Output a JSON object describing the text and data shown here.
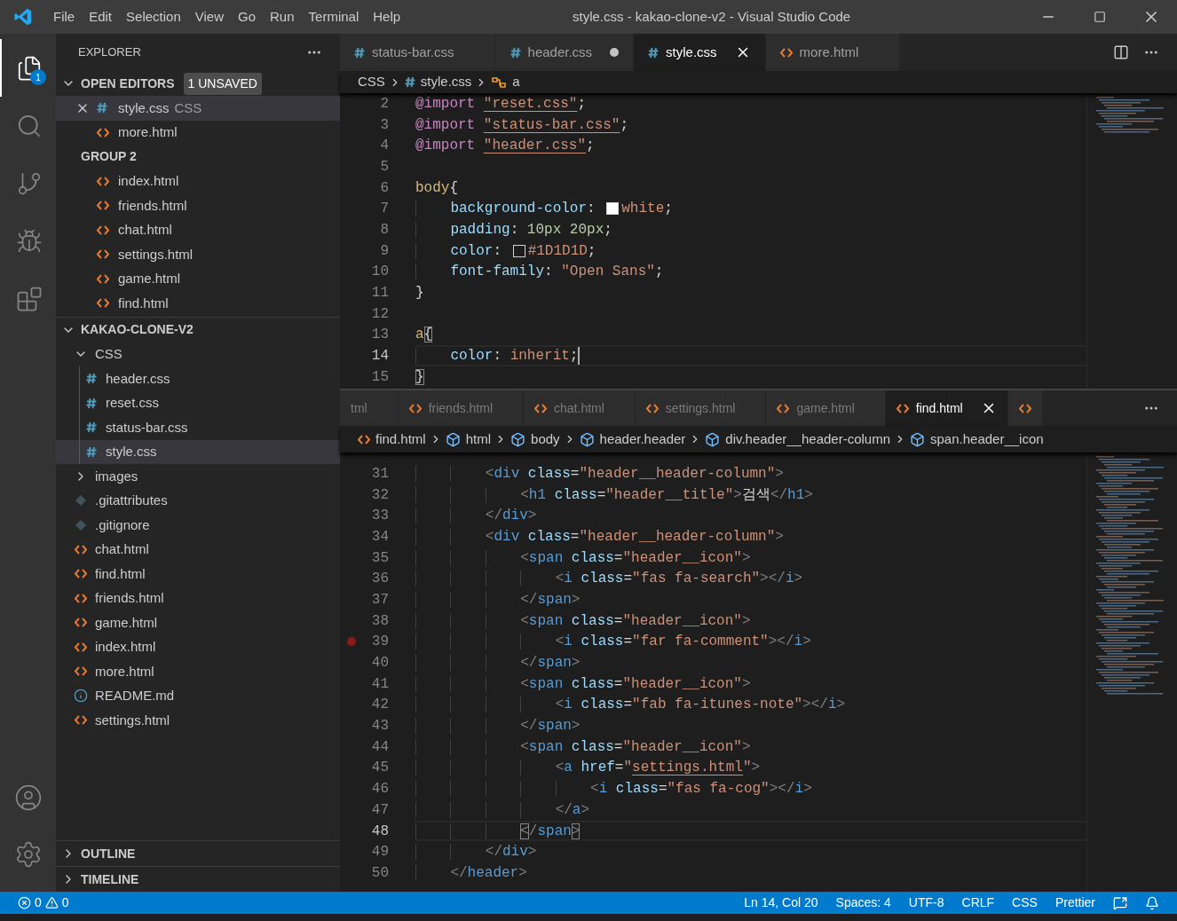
{
  "title_bar": {
    "menu": [
      "File",
      "Edit",
      "Selection",
      "View",
      "Go",
      "Run",
      "Terminal",
      "Help"
    ],
    "title": "style.css - kakao-clone-v2 - Visual Studio Code"
  },
  "activity_bar": {
    "items": [
      {
        "kind": "files",
        "selected": true,
        "badge": "1"
      },
      {
        "kind": "search",
        "selected": false
      },
      {
        "kind": "source-control",
        "selected": false
      },
      {
        "kind": "run",
        "selected": false
      },
      {
        "kind": "extensions",
        "selected": false
      }
    ],
    "bottom": [
      {
        "kind": "account"
      },
      {
        "kind": "settings"
      }
    ]
  },
  "sidebar": {
    "title": "EXPLORER",
    "open_editors": {
      "label": "OPEN EDITORS",
      "expanded": true,
      "badge": "1 UNSAVED",
      "groups": [
        {
          "items": [
            {
              "name": "style.css",
              "kind": "css",
              "selected": true,
              "close": true,
              "suffix": "CSS"
            },
            {
              "name": "more.html",
              "kind": "html",
              "selected": false,
              "close": false
            }
          ]
        },
        {
          "title": "GROUP 2",
          "items": [
            {
              "name": "index.html",
              "kind": "html",
              "selected": false,
              "close": false
            },
            {
              "name": "friends.html",
              "kind": "html",
              "selected": false,
              "close": false
            },
            {
              "name": "chat.html",
              "kind": "html",
              "selected": false,
              "close": false
            },
            {
              "name": "settings.html",
              "kind": "html",
              "selected": false,
              "close": false
            },
            {
              "name": "game.html",
              "kind": "html",
              "selected": false,
              "close": false
            },
            {
              "name": "find.html",
              "kind": "html",
              "selected": false,
              "close": false
            }
          ]
        }
      ]
    },
    "folder": {
      "label": "KAKAO-CLONE-V2",
      "expanded": true,
      "children": [
        {
          "name": "CSS",
          "kind": "folder",
          "expanded": true,
          "selected": false,
          "children": [
            {
              "name": "header.css",
              "kind": "css",
              "selected": false
            },
            {
              "name": "reset.css",
              "kind": "css",
              "selected": false
            },
            {
              "name": "status-bar.css",
              "kind": "css",
              "selected": false
            },
            {
              "name": "style.css",
              "kind": "css",
              "selected": true
            }
          ]
        },
        {
          "name": "images",
          "kind": "folder",
          "expanded": false,
          "selected": false
        },
        {
          "name": ".gitattributes",
          "kind": "git",
          "selected": false
        },
        {
          "name": ".gitignore",
          "kind": "git",
          "selected": false
        },
        {
          "name": "chat.html",
          "kind": "html",
          "selected": false
        },
        {
          "name": "find.html",
          "kind": "html",
          "selected": false
        },
        {
          "name": "friends.html",
          "kind": "html",
          "selected": false
        },
        {
          "name": "game.html",
          "kind": "html",
          "selected": false
        },
        {
          "name": "index.html",
          "kind": "html",
          "selected": false
        },
        {
          "name": "more.html",
          "kind": "html",
          "selected": false
        },
        {
          "name": "README.md",
          "kind": "info",
          "selected": false
        },
        {
          "name": "settings.html",
          "kind": "html",
          "selected": false
        }
      ]
    },
    "panels": [
      {
        "label": "OUTLINE",
        "expanded": false
      },
      {
        "label": "TIMELINE",
        "expanded": false
      }
    ]
  },
  "editor_1": {
    "tabs": [
      {
        "label": "status-bar.css",
        "kind": "css",
        "selected": false,
        "dirty": false,
        "close": false
      },
      {
        "label": "header.css",
        "kind": "css",
        "selected": false,
        "dirty": true,
        "close": false
      },
      {
        "label": "style.css",
        "kind": "css",
        "selected": true,
        "dirty": false,
        "close": true
      },
      {
        "label": "more.html",
        "kind": "html",
        "selected": false,
        "dirty": false,
        "close": false
      }
    ],
    "breadcrumbs": [
      {
        "label": "CSS",
        "kind": "none"
      },
      {
        "label": "style.css",
        "kind": "css"
      },
      {
        "label": "a",
        "kind": "symbol"
      }
    ],
    "lines": [
      {
        "n": "2",
        "text": "@import \"reset.css\";"
      },
      {
        "n": "3",
        "text": "@import \"status-bar.css\";"
      },
      {
        "n": "4",
        "text": "@import \"header.css\";"
      },
      {
        "n": "5"
      },
      {
        "n": "6",
        "text": "body{"
      },
      {
        "n": "7",
        "segments": [
          {
            "kind": "code",
            "text": "    background-color: "
          },
          {
            "kind": "swatch",
            "color": "#ffffff"
          },
          {
            "kind": "code",
            "text": "white;"
          }
        ]
      },
      {
        "n": "8",
        "text": "    padding: 10px 20px;"
      },
      {
        "n": "9",
        "segments": [
          {
            "kind": "code",
            "text": "    color: "
          },
          {
            "kind": "swatch",
            "color": "#1d1d1d"
          },
          {
            "kind": "code",
            "text": "#1D1D1D;"
          }
        ]
      },
      {
        "n": "10",
        "text": "    font-family: \"Open Sans\";"
      },
      {
        "n": "11",
        "text": "}"
      },
      {
        "n": "12"
      },
      {
        "n": "13",
        "text": "a{",
        "bracket_match": true
      },
      {
        "n": "14",
        "text": "    color: inherit;",
        "current": true,
        "cursor": true
      },
      {
        "n": "15",
        "text": "}",
        "bracket_match": true
      }
    ]
  },
  "editor_2": {
    "tabs": [
      {
        "label": "tml",
        "kind": "none",
        "selected": false,
        "dirty": false,
        "close": false
      },
      {
        "label": "friends.html",
        "kind": "html",
        "selected": false,
        "dirty": false,
        "close": false
      },
      {
        "label": "chat.html",
        "kind": "html",
        "selected": false,
        "dirty": false,
        "close": false
      },
      {
        "label": "settings.html",
        "kind": "html",
        "selected": false,
        "dirty": false,
        "close": false
      },
      {
        "label": "game.html",
        "kind": "html",
        "selected": false,
        "dirty": false,
        "close": false
      },
      {
        "label": "find.html",
        "kind": "html",
        "selected": true,
        "dirty": false,
        "close": true
      },
      {
        "kind": "html",
        "selected": false,
        "dirty": false,
        "close": false
      }
    ],
    "breadcrumbs": [
      {
        "label": "find.html",
        "kind": "html"
      },
      {
        "label": "html",
        "kind": "element"
      },
      {
        "label": "body",
        "kind": "element"
      },
      {
        "label": "header.header",
        "kind": "element"
      },
      {
        "label": "div.header__header-column",
        "kind": "element"
      },
      {
        "label": "span.header__icon",
        "kind": "element"
      }
    ],
    "lines": [
      {
        "n": "31",
        "text": "        <div class=\"header__header-column\">"
      },
      {
        "n": "32",
        "text": "            <h1 class=\"header__title\">검색</h1>"
      },
      {
        "n": "33",
        "text": "        </div>"
      },
      {
        "n": "34",
        "text": "        <div class=\"header__header-column\">"
      },
      {
        "n": "35",
        "text": "            <span class=\"header__icon\">"
      },
      {
        "n": "36",
        "text": "                <i class=\"fas fa-search\"></i>"
      },
      {
        "n": "37",
        "text": "            </span>"
      },
      {
        "n": "38",
        "text": "            <span class=\"header__icon\">"
      },
      {
        "n": "39",
        "text": "                <i class=\"far fa-comment\"></i>",
        "breakpoint": true
      },
      {
        "n": "40",
        "text": "            </span>"
      },
      {
        "n": "41",
        "text": "            <span class=\"header__icon\">"
      },
      {
        "n": "42",
        "text": "                <i class=\"fab fa-itunes-note\"></i>"
      },
      {
        "n": "43",
        "text": "            </span>"
      },
      {
        "n": "44",
        "text": "            <span class=\"header__icon\">"
      },
      {
        "n": "45",
        "text": "                <a href=\"settings.html\">"
      },
      {
        "n": "46",
        "text": "                    <i class=\"fas fa-cog\"></i>"
      },
      {
        "n": "47",
        "text": "                </a>"
      },
      {
        "n": "48",
        "text": "            </span>",
        "current": true,
        "bracket_match": true
      },
      {
        "n": "49",
        "text": "        </div>"
      },
      {
        "n": "50",
        "text": "    </header>"
      }
    ]
  },
  "status_bar": {
    "errors": "0",
    "warnings": "0",
    "items": [
      "Ln 14, Col 20",
      "Spaces: 4",
      "UTF-8",
      "CRLF",
      "CSS",
      "Prettier"
    ]
  }
}
